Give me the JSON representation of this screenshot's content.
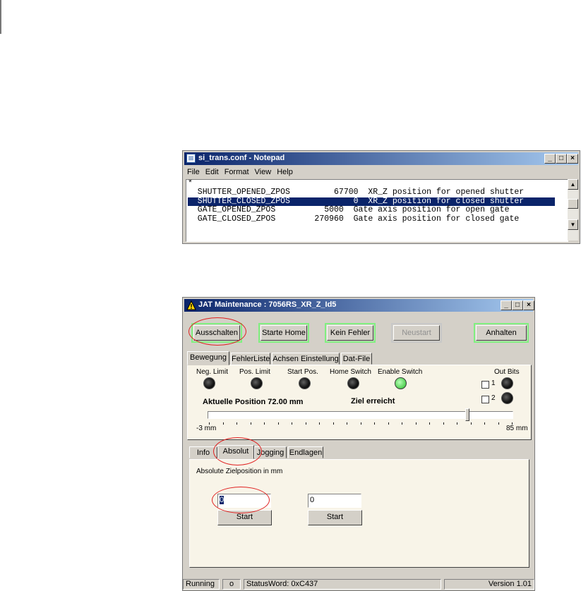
{
  "notepad": {
    "title": "si_trans.conf - Notepad",
    "menu": [
      "File",
      "Edit",
      "Format",
      "View",
      "Help"
    ],
    "lines": [
      "*",
      "  SHUTTER_OPENED_ZPOS         67700  XR_Z position for opened shutter",
      "  SHUTTER_CLOSED_ZPOS             0  XR_Z position for closed shutter",
      "  GATE_OPENED_ZPOS          5000  Gate axis position for open gate",
      "  GATE_CLOSED_ZPOS        270960  Gate axis position for closed gate"
    ],
    "selected_line_index": 2,
    "window_buttons": {
      "minimize": "_",
      "maximize": "□",
      "close": "×"
    },
    "scroll": {
      "up": "▲",
      "down": "▼"
    }
  },
  "jat": {
    "title": "JAT Maintenance : 7056RS_XR_Z_Id5",
    "window_buttons": {
      "minimize": "_",
      "maximize": "□",
      "close": "×"
    },
    "buttons": {
      "ausschalten": "Ausschalten",
      "starte_home": "Starte Home",
      "kein_fehler": "Kein Fehler",
      "neustart": "Neustart",
      "anhalten": "Anhalten"
    },
    "main_tabs": [
      "Bewegung",
      "FehlerListe",
      "Achsen Einstellung",
      "Dat-File"
    ],
    "indicators": {
      "neg_limit": "Neg. Limit",
      "pos_limit": "Pos. Limit",
      "start_pos": "Start Pos.",
      "home_switch": "Home Switch",
      "enable_switch": "Enable Switch",
      "out_bits": "Out Bits",
      "bit1": "1",
      "bit2": "2"
    },
    "position_text": "Aktuelle Position 72.00 mm",
    "target_status": "Ziel erreicht",
    "slider": {
      "min_label": "-3 mm",
      "max_label": "85 mm",
      "min": -3,
      "max": 85,
      "value": 72.0
    },
    "sub_tabs": [
      "Info",
      "Absolut",
      "Jogging",
      "Endlagen"
    ],
    "absolut": {
      "label": "Absolute Zielposition in mm",
      "input1_value": "0",
      "input2_value": "0",
      "start1": "Start",
      "start2": "Start"
    },
    "status": {
      "running": "Running",
      "o": "o",
      "status_word": "StatusWord: 0xC437",
      "version": "Version 1.01"
    }
  },
  "colors": {
    "title_gradient_start": "#0a246a",
    "title_gradient_end": "#a6caf0",
    "button_green_border": "#80f080",
    "annotation_red": "#e02020",
    "led_green": "#52d052",
    "panel_bg": "#f8f4e8",
    "face": "#d4d0c8"
  }
}
